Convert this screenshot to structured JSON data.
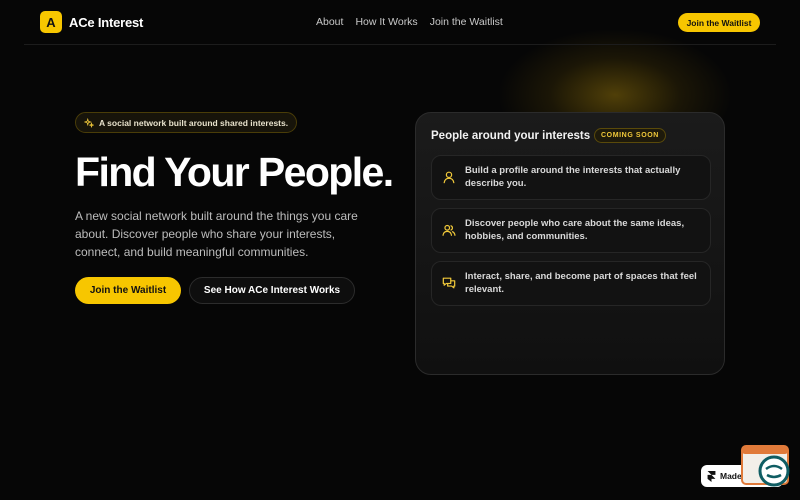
{
  "brand": {
    "logo_letter": "A",
    "name": "ACe Interest",
    "accent": "#f7c600"
  },
  "nav": {
    "items": [
      "About",
      "How It Works",
      "Join the Waitlist"
    ],
    "cta": "Join the Waitlist"
  },
  "hero": {
    "pill": "A social network built around shared interests.",
    "title": "Find Your People.",
    "lead": "A new social network built around the things you care about. Discover people who share your interests, connect, and build meaningful communities.",
    "primary_cta": "Join the Waitlist",
    "secondary_cta": "See How ACe Interest Works"
  },
  "card": {
    "title": "People around your interests",
    "badge": "COMING SOON",
    "features": [
      {
        "icon": "user-icon",
        "text": "Build a profile around the interests that actually describe you."
      },
      {
        "icon": "users-icon",
        "text": "Discover people who care about the same ideas, hobbies, and communities."
      },
      {
        "icon": "chat-icon",
        "text": "Interact, share, and become part of spaces that feel relevant."
      }
    ]
  },
  "framer_badge": {
    "label": "Made in Framer"
  }
}
